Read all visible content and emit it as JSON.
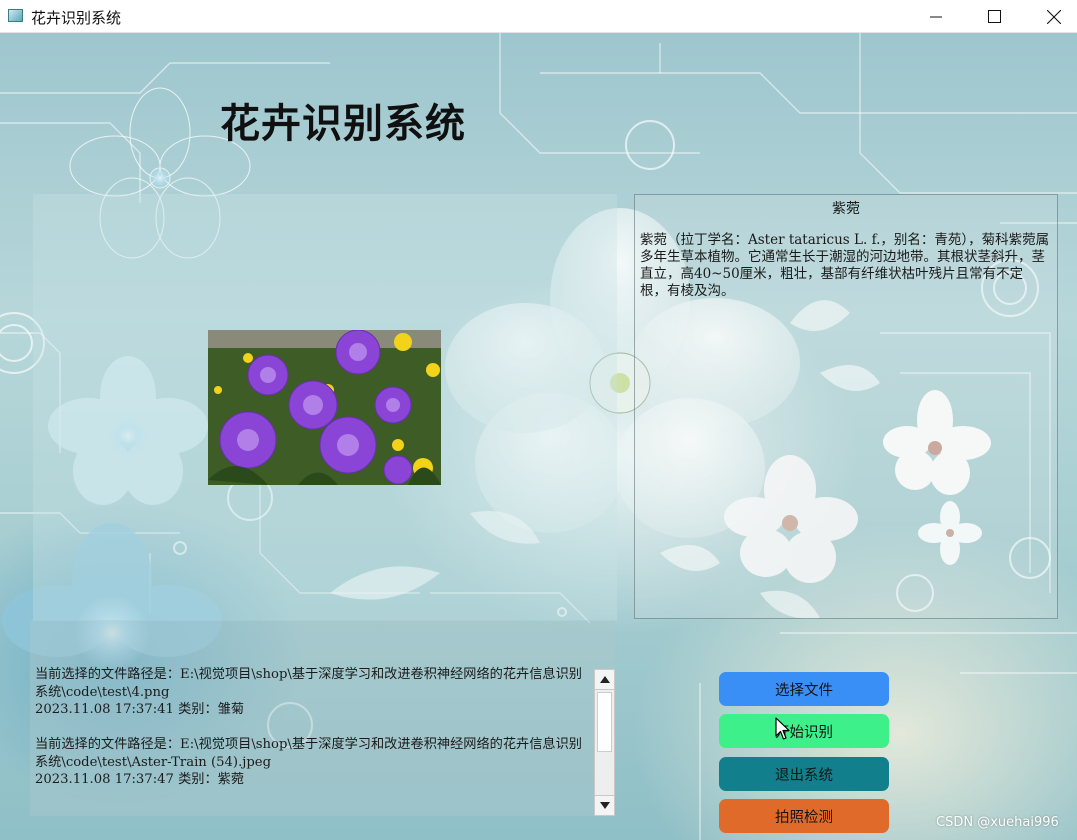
{
  "window": {
    "title": "花卉识别系统",
    "icons": {
      "app": "app-window-icon",
      "minimize": "minimize-icon",
      "maximize": "maximize-icon",
      "close": "close-icon"
    }
  },
  "header": {
    "title": "花卉识别系统"
  },
  "result": {
    "name": "紫菀",
    "description": "紫菀（拉丁学名：Aster tataricus L. f.，别名：青苑），菊科紫菀属多年生草本植物。它通常生长于潮湿的河边地带。其根状茎斜升，茎直立，高40~50厘米，粗壮，基部有纤维状枯叶残片且常有不定根，有棱及沟。"
  },
  "log": {
    "entries": [
      {
        "path_line": "当前选择的文件路径是：E:\\视觉项目\\shop\\基于深度学习和改进卷积神经网络的花卉信息识别系统\\code\\test\\4.png",
        "result_line": "2023.11.08 17:37:41 类别：雏菊"
      },
      {
        "path_line": "当前选择的文件路径是：E:\\视觉项目\\shop\\基于深度学习和改进卷积神经网络的花卉信息识别系统\\code\\test\\Aster-Train (54).jpeg",
        "result_line": "2023.11.08 17:37:47 类别：紫菀"
      }
    ]
  },
  "buttons": {
    "select_file": "选择文件",
    "start_recognition": "开始识别",
    "exit_system": "退出系统",
    "camera_detect": "拍照检测"
  },
  "colors": {
    "select_file": "#3a8ff7",
    "start_recognition": "#3df08a",
    "exit_system": "#12808c",
    "camera_detect": "#e06a2a"
  },
  "watermark": "CSDN @xuehai996"
}
